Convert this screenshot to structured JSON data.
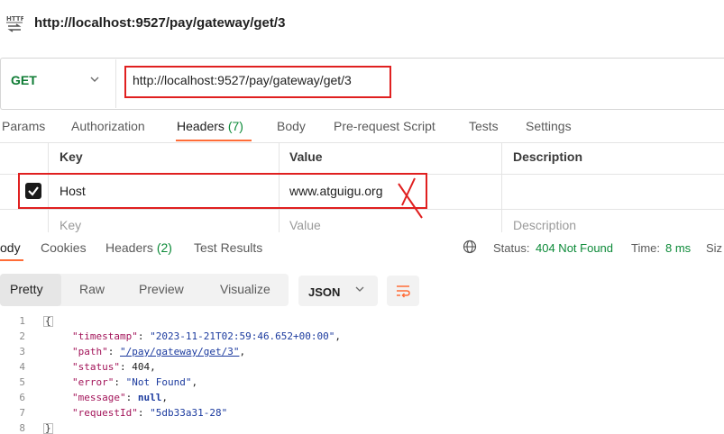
{
  "window": {
    "title": "http://localhost:9527/pay/gateway/get/3",
    "icon": "http-icon"
  },
  "request": {
    "method": "GET",
    "url": "http://localhost:9527/pay/gateway/get/3"
  },
  "tabs": [
    {
      "label": "Params"
    },
    {
      "label": "Authorization"
    },
    {
      "label": "Headers",
      "count": "(7)",
      "active": true
    },
    {
      "label": "Body"
    },
    {
      "label": "Pre-request Script"
    },
    {
      "label": "Tests"
    },
    {
      "label": "Settings"
    }
  ],
  "headers_table": {
    "columns": [
      "Key",
      "Value",
      "Description"
    ],
    "rows": [
      {
        "checked": true,
        "key": "Host",
        "value": "www.atguigu.org",
        "description": ""
      }
    ],
    "placeholders": {
      "key": "Key",
      "value": "Value",
      "description": "Description"
    }
  },
  "response": {
    "tabs": [
      {
        "label": "ody",
        "active": true
      },
      {
        "label": "Cookies"
      },
      {
        "label": "Headers",
        "count": "(2)"
      },
      {
        "label": "Test Results"
      }
    ],
    "status_label": "Status:",
    "status_value": "404 Not Found",
    "time_label": "Time:",
    "time_value": "8 ms",
    "size_label": "Siz",
    "format_modes": [
      "Pretty",
      "Raw",
      "Preview",
      "Visualize"
    ],
    "active_format": "Pretty",
    "language": "JSON",
    "body": {
      "line_numbers": [
        "1",
        "2",
        "3",
        "4",
        "5",
        "6",
        "7",
        "8"
      ],
      "timestamp_key": "\"timestamp\"",
      "timestamp_val": "\"2023-11-21T02:59:46.652+00:00\"",
      "path_key": "\"path\"",
      "path_val": "\"/pay/gateway/get/3\"",
      "status_key": "\"status\"",
      "status_val": "404",
      "error_key": "\"error\"",
      "error_val": "\"Not Found\"",
      "message_key": "\"message\"",
      "message_val": "null",
      "requestId_key": "\"requestId\"",
      "requestId_val": "\"5db33a31-28\"",
      "open": "{",
      "close": "}"
    }
  },
  "colors": {
    "accent": "#ff6c37",
    "method_get": "#0c7a32",
    "status": "#0c8a38",
    "annotation": "#e02020"
  }
}
